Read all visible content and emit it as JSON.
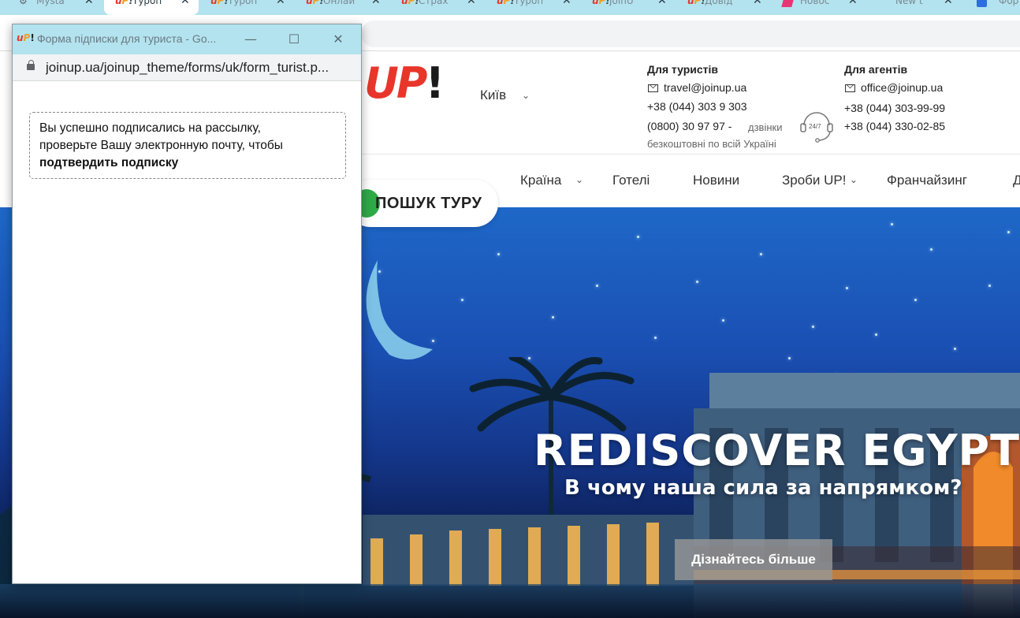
{
  "browser": {
    "tabs": [
      {
        "title": "Mysta",
        "icon": "gear-icon"
      },
      {
        "title": "Туроп",
        "icon": "joinup-favicon",
        "active": true
      },
      {
        "title": "Туроп",
        "icon": "joinup-favicon"
      },
      {
        "title": "Онлай",
        "icon": "joinup-favicon"
      },
      {
        "title": "Страх",
        "icon": "joinup-favicon"
      },
      {
        "title": "Туроп",
        "icon": "joinup-favicon"
      },
      {
        "title": "JoinU",
        "icon": "joinup-favicon"
      },
      {
        "title": "Довід",
        "icon": "joinup-favicon"
      },
      {
        "title": "Новос",
        "icon": "pink-favicon"
      },
      {
        "title": "New t",
        "icon": "red-favicon"
      },
      {
        "title": "Фор",
        "icon": "blue-favicon"
      }
    ],
    "favicon_text": {
      "u": "u",
      "p": "P",
      "ex": "!"
    },
    "tab_close": "✕"
  },
  "popup": {
    "title": "Форма підписки для туриста - Go...",
    "url": "joinup.ua/joinup_theme/forms/uk/form_turist.p...",
    "controls": {
      "minimize": "—",
      "maximize": "☐",
      "close": "✕"
    },
    "message": {
      "line1": "Вы успешно подписались на рассылку,",
      "line2": "проверьте Вашу электронную почту, чтобы",
      "line3": "подтвердить подписку"
    }
  },
  "site": {
    "logo": {
      "u": "U",
      "p": "P",
      "ex": "!"
    },
    "city": "Київ",
    "tourists": {
      "heading": "Для туристів",
      "email": "travel@joinup.ua",
      "phone1": "+38 (044) 303 9 303",
      "phone2": "(0800) 30 97 97 -",
      "phone2_note": "дзвінки",
      "phone2_note2": "безкоштовні по всій Україні"
    },
    "agents": {
      "heading": "Для агентів",
      "email": "office@joinup.ua",
      "phone1": "+38 (044) 303-99-99",
      "phone2": "+38 (044) 330-02-85"
    },
    "support_label": "24/7",
    "nav": [
      "Країна",
      "Готелі",
      "Новини",
      "Зроби UP!",
      "Франчайзинг",
      "Д"
    ],
    "search_button": "ПОШУК ТУРУ",
    "hero": {
      "title": "REDISCOVER EGYPT",
      "subtitle": "В чому наша сила за напрямком?",
      "button": "Дізнайтесь більше"
    }
  },
  "colors": {
    "tab_strip": "#b3e3ee",
    "brand_red": "#e8362b",
    "brand_green": "#2eaa47",
    "hero_sky": "#1a4fb2"
  }
}
